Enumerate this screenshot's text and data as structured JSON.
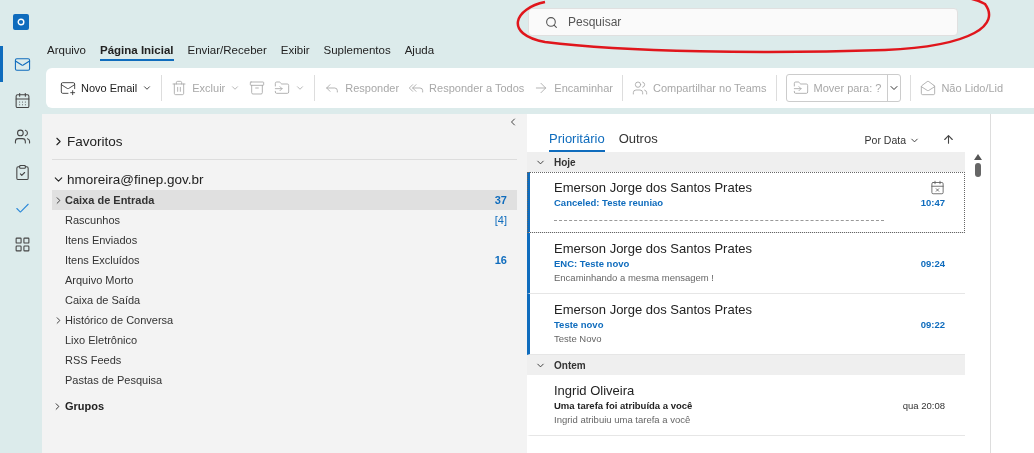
{
  "search": {
    "placeholder": "Pesquisar"
  },
  "menu_tabs": [
    {
      "label": "Arquivo",
      "selected": false
    },
    {
      "label": "Página Inicial",
      "selected": true
    },
    {
      "label": "Enviar/Receber",
      "selected": false
    },
    {
      "label": "Exibir",
      "selected": false
    },
    {
      "label": "Suplementos",
      "selected": false
    },
    {
      "label": "Ajuda",
      "selected": false
    }
  ],
  "ribbon": [
    {
      "kind": "new-mail",
      "label": "Novo Email",
      "disabled": false,
      "dropdown": true
    },
    {
      "kind": "separator"
    },
    {
      "kind": "delete",
      "label": "Excluir",
      "disabled": true,
      "dropdown": true
    },
    {
      "kind": "archive",
      "disabled": true,
      "dropdown": false
    },
    {
      "kind": "move",
      "disabled": true,
      "dropdown": true
    },
    {
      "kind": "separator"
    },
    {
      "kind": "reply",
      "label": "Responder",
      "disabled": true,
      "dropdown": false
    },
    {
      "kind": "reply-all",
      "label": "Responder a Todos",
      "disabled": true,
      "dropdown": false
    },
    {
      "kind": "forward",
      "label": "Encaminhar",
      "disabled": true,
      "dropdown": false
    },
    {
      "kind": "separator"
    },
    {
      "kind": "teams",
      "label": "Compartilhar no Teams",
      "disabled": true,
      "dropdown": false
    },
    {
      "kind": "separator"
    },
    {
      "kind": "combo",
      "label": "Mover para: ?"
    },
    {
      "kind": "separator"
    },
    {
      "kind": "read",
      "label": "Não Lido/Lid",
      "disabled": true,
      "dropdown": false
    }
  ],
  "rail": [
    {
      "selected": true
    },
    {
      "selected": false
    },
    {
      "selected": false
    },
    {
      "selected": false
    },
    {
      "selected": false
    },
    {
      "selected": false
    }
  ],
  "favorites": {
    "label": "Favoritos",
    "expanded": false
  },
  "account": {
    "label": "hmoreira@finep.gov.br",
    "expanded": true
  },
  "folders": [
    {
      "name": "Caixa de Entrada",
      "count": "37",
      "kind": "unread-count",
      "has_children": true,
      "selected": true
    },
    {
      "name": "Rascunhos",
      "count": "[4]",
      "kind": "total-count",
      "has_children": false,
      "selected": false
    },
    {
      "name": "Itens Enviados",
      "has_children": false,
      "selected": false
    },
    {
      "name": "Itens Excluídos",
      "count": "16",
      "kind": "unread-count",
      "has_children": false,
      "selected": false
    },
    {
      "name": "Arquivo Morto",
      "has_children": false,
      "selected": false
    },
    {
      "name": "Caixa de Saída",
      "has_children": false,
      "selected": false
    },
    {
      "name": "Histórico de Conversa",
      "has_children": true,
      "selected": false
    },
    {
      "name": "Lixo Eletrônico",
      "has_children": false,
      "selected": false
    },
    {
      "name": "RSS Feeds",
      "has_children": false,
      "selected": false
    },
    {
      "name": "Pastas de Pesquisa",
      "has_children": false,
      "selected": false
    }
  ],
  "groups": {
    "label": "Grupos",
    "expanded": false
  },
  "list_tabs": [
    {
      "label": "Prioritário",
      "selected": true
    },
    {
      "label": "Outros",
      "selected": false
    }
  ],
  "sort": {
    "label": "Por Data"
  },
  "message_groups": [
    {
      "label": "Hoje",
      "expanded": true,
      "messages": [
        {
          "kind": "canceled-meeting",
          "sender": "Emerson Jorge dos Santos Prates",
          "subject": "Canceled: Teste reuniao",
          "time": "10:47",
          "unread": true,
          "selected": true
        },
        {
          "kind": "mail",
          "sender": "Emerson Jorge dos Santos Prates",
          "subject": "ENC: Teste novo",
          "preview": "Encaminhando a mesma mensagem !",
          "time": "09:24",
          "unread": true,
          "selected": false
        },
        {
          "kind": "mail",
          "sender": "Emerson Jorge dos Santos Prates",
          "subject": "Teste novo",
          "preview": "Teste Novo",
          "time": "09:22",
          "unread": true,
          "selected": false
        }
      ]
    },
    {
      "label": "Ontem",
      "expanded": true,
      "messages": [
        {
          "kind": "mail",
          "sender": "Ingrid Oliveira",
          "subject": "Uma tarefa foi atribuída a você",
          "preview": "Ingrid atribuiu uma tarefa a você",
          "time": "qua 20:08",
          "unread": false,
          "selected": false
        }
      ]
    }
  ]
}
